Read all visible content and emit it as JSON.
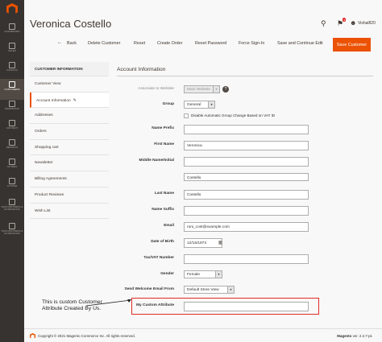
{
  "sidebar": {
    "items": [
      {
        "label": "Dashboard",
        "icon": "dashboard-icon"
      },
      {
        "label": "Sales",
        "icon": "dollar-icon"
      },
      {
        "label": "Catalog",
        "icon": "cube-icon"
      },
      {
        "label": "Customers",
        "icon": "person-icon"
      },
      {
        "label": "Marketing",
        "icon": "megaphone-icon"
      },
      {
        "label": "Content",
        "icon": "layout-icon"
      },
      {
        "label": "Reports",
        "icon": "bar-chart-icon"
      },
      {
        "label": "Stores",
        "icon": "store-icon"
      },
      {
        "label": "System",
        "icon": "gear-icon"
      },
      {
        "label": "Find Partners & Extensions",
        "icon": "box-icon"
      },
      {
        "label": "Find Partners & Extensions",
        "icon": "box-icon"
      }
    ]
  },
  "header": {
    "title": "Veronica Costello",
    "notifications": "1",
    "user": "Vishal820"
  },
  "actions": {
    "back": "Back",
    "delete": "Delete Customer",
    "reset": "Reset",
    "create_order": "Create Order",
    "reset_password": "Reset Password",
    "force_signin": "Force Sign-In",
    "save_continue": "Save and Continue Edit",
    "save": "Save Customer"
  },
  "tabs": {
    "heading": "CUSTOMER INFORMATION",
    "items": [
      "Customer View",
      "Account Information",
      "Addresses",
      "Orders",
      "Shopping cart",
      "Newsletter",
      "Billing Agreements",
      "Product Reviews",
      "Wish List"
    ]
  },
  "form": {
    "section_title": "Account Information",
    "associate_label": "Associate to Website",
    "associate_value": "Main Website",
    "group_label": "Group",
    "group_value": "General",
    "disable_auto_group": "Disable Automatic Group Change Based on VAT ID",
    "name_prefix_label": "Name Prefix",
    "first_name_label": "First Name",
    "first_name_value": "Veronica",
    "middle_name_label": "Middle Name/Initial",
    "last_name_label": "Last Name",
    "last_name_value": "Costello",
    "name_suffix_label": "Name Suffix",
    "email_label": "Email",
    "email_value": "roni_cost@example.com",
    "dob_label": "Date of Birth",
    "dob_value": "12/15/1973",
    "tax_label": "Tax/VAT Number",
    "gender_label": "Gender",
    "gender_value": "Female",
    "welcome_label": "Send Welcome Email From",
    "welcome_value": "Default Store View",
    "custom_attr_label": "My Custom Attribute"
  },
  "callout": {
    "line1": "This is custom Customer",
    "line2": "Attribute Created By Us."
  },
  "footer": {
    "copyright": "Copyright © 2021 Magento Commerce Inc. All rights reserved.",
    "brand": "Magento",
    "version": "ver. 2.3.7-p1"
  },
  "colors": {
    "accent": "#eb5202",
    "sidebar": "#373330",
    "callout": "#e02b27"
  }
}
